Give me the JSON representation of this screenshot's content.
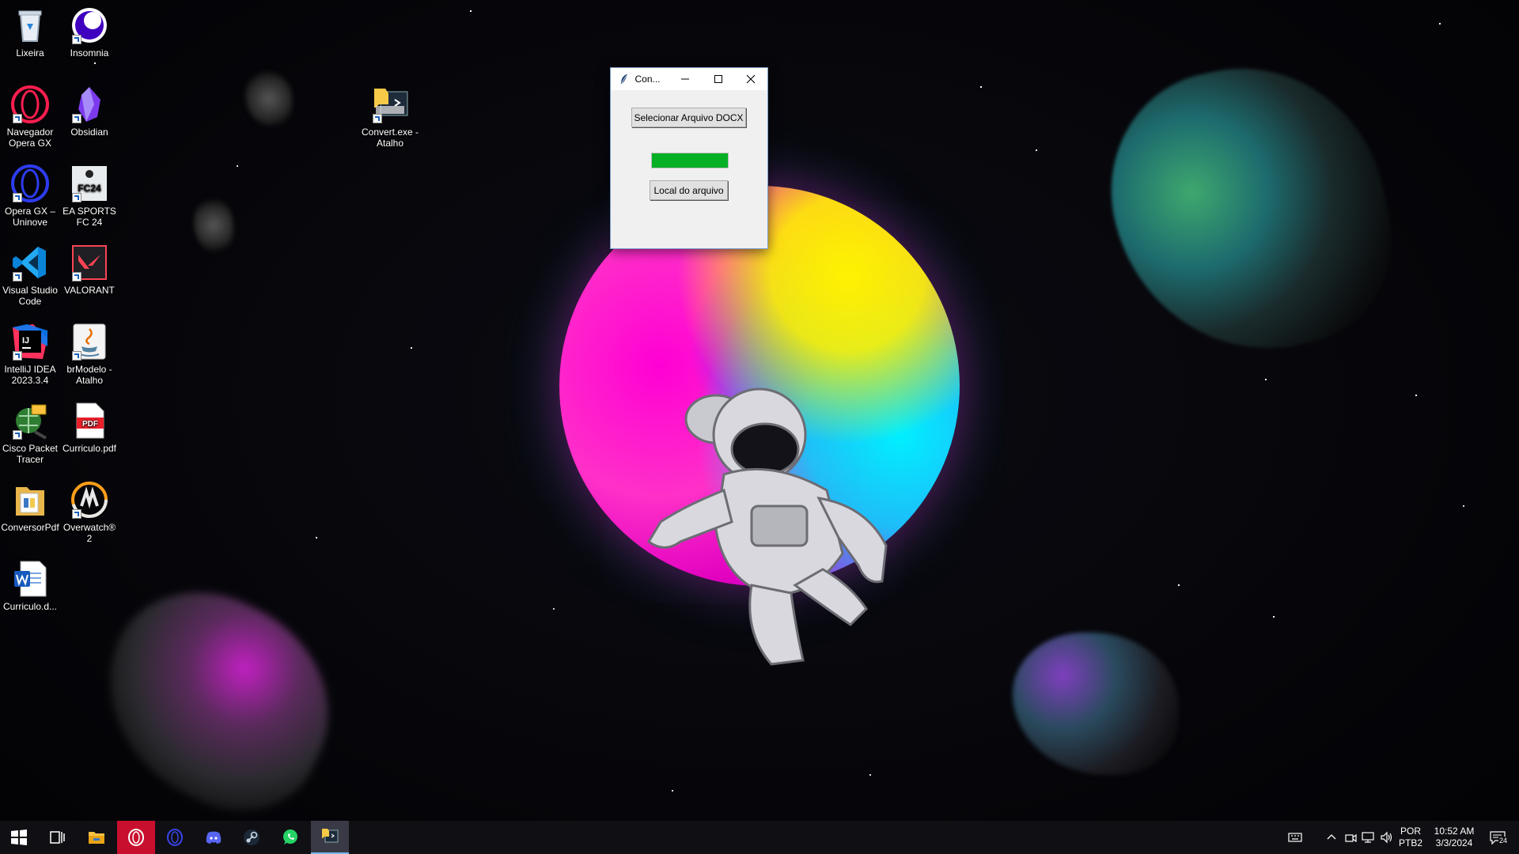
{
  "desktop": {
    "icons": [
      {
        "label": "Lixeira",
        "icon": "recycle-bin-icon"
      },
      {
        "label": "Insomnia",
        "icon": "insomnia-icon"
      },
      {
        "label": "Navegador Opera GX",
        "icon": "opera-gx-icon"
      },
      {
        "label": "Obsidian",
        "icon": "obsidian-icon"
      },
      {
        "label": "Opera GX – Uninove",
        "icon": "opera-gx-uninove-icon"
      },
      {
        "label": "EA SPORTS FC 24",
        "icon": "ea-sports-fc24-icon"
      },
      {
        "label": "Visual Studio Code",
        "icon": "vscode-icon"
      },
      {
        "label": "VALORANT",
        "icon": "valorant-icon"
      },
      {
        "label": "IntelliJ IDEA 2023.3.4",
        "icon": "intellij-icon"
      },
      {
        "label": "brModelo - Atalho",
        "icon": "java-brmodelo-icon"
      },
      {
        "label": "Cisco Packet Tracer",
        "icon": "cisco-packet-tracer-icon"
      },
      {
        "label": "Curriculo.pdf",
        "icon": "pdf-file-icon"
      },
      {
        "label": "ConversorPdf",
        "icon": "folder-icon"
      },
      {
        "label": "Overwatch® 2",
        "icon": "overwatch-icon"
      },
      {
        "label": "Curriculo.d...",
        "icon": "word-document-icon"
      },
      {
        "label": "Convert.exe - Atalho",
        "icon": "python-exe-icon"
      }
    ],
    "pdf_badge": "PDF",
    "fc_badge": "FC24",
    "ij_badge": "IJ"
  },
  "app_window": {
    "title": "Con...",
    "select_button": "Selecionar Arquivo DOCX",
    "location_button": "Local do arquivo",
    "progress": 1.0,
    "progress_color": "#06b025"
  },
  "taskbar": {
    "apps": [
      "windows-start-icon",
      "task-view-icon",
      "file-explorer-icon",
      "opera-gx-icon",
      "opera-icon",
      "discord-icon",
      "steam-icon",
      "whatsapp-icon",
      "python-app-icon"
    ],
    "language_line1": "POR",
    "language_line2": "PTB2",
    "time": "10:52 AM",
    "date": "3/3/2024",
    "notification_count": "24"
  },
  "colors": {
    "taskbar_bg": "#101014",
    "accent": "#76b9ed"
  }
}
